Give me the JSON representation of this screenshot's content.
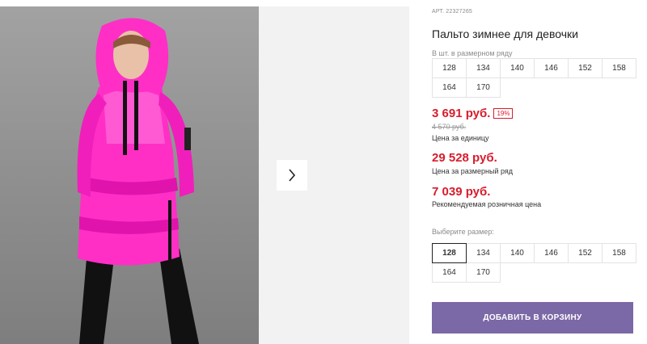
{
  "product": {
    "sku_label": "АРТ.",
    "sku": "22327265",
    "title": "Пальто зимнее для девочки",
    "image_alt": "Розовое пальто",
    "colors": {
      "accent_red": "#d71c2c",
      "button": "#7b68a6",
      "coat": "#ff2fc6"
    }
  },
  "gallery": {
    "next_icon": "chevron-right-icon"
  },
  "pack": {
    "hint": "В шт. в размерном ряду",
    "sizes": [
      "128",
      "134",
      "140",
      "146",
      "152",
      "158",
      "164",
      "170"
    ]
  },
  "pricing": {
    "unit_price": "3 691 руб.",
    "discount": "19%",
    "old_price": "4 570 руб.",
    "unit_caption": "Цена за единицу",
    "pack_price": "29 528 руб.",
    "pack_caption": "Цена за размерный ряд",
    "retail_price": "7 039 руб.",
    "retail_caption": "Рекомендуемая розничная цена"
  },
  "size_select": {
    "hint": "Выберите размер:",
    "selected": "128",
    "sizes": [
      "128",
      "134",
      "140",
      "146",
      "152",
      "158",
      "164",
      "170"
    ]
  },
  "cart": {
    "add_label": "ДОБАВИТЬ В КОРЗИНУ"
  }
}
